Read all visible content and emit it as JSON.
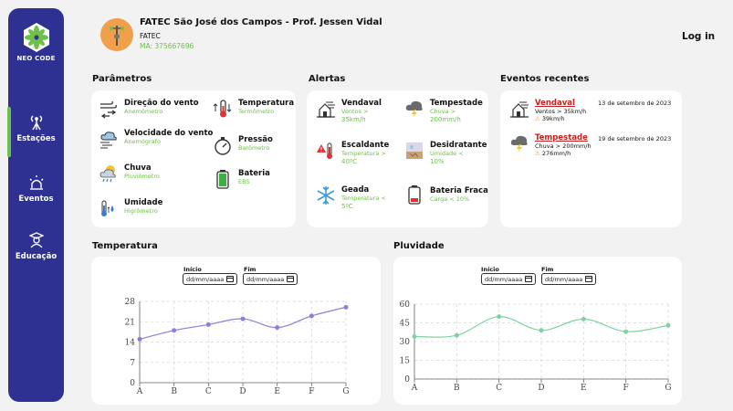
{
  "brand": {
    "logo_text_a": "NEO",
    "logo_text_b": "CODE"
  },
  "nav": [
    {
      "label": "Estações",
      "icon": "antenna-icon",
      "active": true
    },
    {
      "label": "Eventos",
      "icon": "siren-icon",
      "active": false
    },
    {
      "label": "Educação",
      "icon": "graduate-icon",
      "active": false
    }
  ],
  "header": {
    "title": "FATEC São José dos Campos - Prof. Jessen Vidal",
    "short": "FATEC",
    "ma": "MA: 375667696",
    "login": "Log in"
  },
  "sections": {
    "parametros": "Parâmetros",
    "alertas": "Alertas",
    "eventos": "Eventos recentes",
    "temperatura": "Temperatura",
    "pluvidade": "Pluvidade"
  },
  "parametros": [
    {
      "title": "Direção do vento",
      "sub": "Anemômetro",
      "icon": "wind-direction-icon"
    },
    {
      "title": "Temperatura",
      "sub": "Termômetro",
      "icon": "thermometer-icon"
    },
    {
      "title": "Velocidade do vento",
      "sub": "Anemógrafo",
      "icon": "wind-speed-icon"
    },
    {
      "title": "Pressão",
      "sub": "Barômetro",
      "icon": "gauge-icon"
    },
    {
      "title": "Chuva",
      "sub": "Pluviômetro",
      "icon": "rain-icon"
    },
    {
      "title": "Bateria",
      "sub": "EBS",
      "icon": "battery-icon"
    },
    {
      "title": "Umidade",
      "sub": "Higrômetro",
      "icon": "humidity-icon"
    }
  ],
  "alertas": [
    {
      "title": "Vendaval",
      "sub1": "Ventos >",
      "sub2": "35km/h",
      "icon": "windy-house-icon"
    },
    {
      "title": "Tempestade",
      "sub1": "Chuva >",
      "sub2": "200mm/h",
      "icon": "storm-icon"
    },
    {
      "title": "Escaldante",
      "sub1": "Temperatura >",
      "sub2": "40ºC",
      "icon": "hot-thermometer-icon"
    },
    {
      "title": "Desidratante",
      "sub1": "Umidade <",
      "sub2": "10%",
      "icon": "drought-icon"
    },
    {
      "title": "Geada",
      "sub1": "Temperatura <",
      "sub2": "5ºC",
      "icon": "snowflake-icon"
    },
    {
      "title": "Bateria Fraca",
      "sub1": "Carga < 10%",
      "sub2": "",
      "icon": "low-battery-icon"
    }
  ],
  "eventos": [
    {
      "title": "Vendaval",
      "desc": "Ventos > 35km/h",
      "value": "39km/h",
      "date": "13 de setembro de 2023",
      "icon": "windy-house-icon"
    },
    {
      "title": "Tempestade",
      "desc": "Chuva > 200mm/h",
      "value": "276mm/h",
      "date": "19 de setembro de 2023",
      "icon": "storm-icon"
    }
  ],
  "filters": {
    "inicio": "Início",
    "fim": "Fim",
    "placeholder": "dd/mm/aaaa"
  },
  "colors": {
    "sidebar": "#2e3192",
    "accent": "#6dc04a",
    "alert": "#c62020",
    "temp_line": "#8b7fd8",
    "rain_line": "#7ed3a0"
  },
  "chart_data": [
    {
      "type": "line",
      "categories": [
        "A",
        "B",
        "C",
        "D",
        "E",
        "F",
        "G"
      ],
      "series": [
        {
          "values": [
            15,
            18,
            20,
            22,
            19,
            23,
            26
          ]
        }
      ],
      "yticks": [
        "0",
        "7",
        "14",
        "21",
        "28"
      ],
      "ylim": [
        0,
        28
      ],
      "grid": true
    },
    {
      "type": "line",
      "categories": [
        "A",
        "B",
        "C",
        "D",
        "E",
        "F",
        "G"
      ],
      "series": [
        {
          "values": [
            34,
            35,
            50,
            39,
            48,
            38,
            43
          ]
        }
      ],
      "yticks": [
        "0",
        "15",
        "30",
        "45",
        "60"
      ],
      "ylim": [
        0,
        60
      ],
      "grid": true
    }
  ]
}
